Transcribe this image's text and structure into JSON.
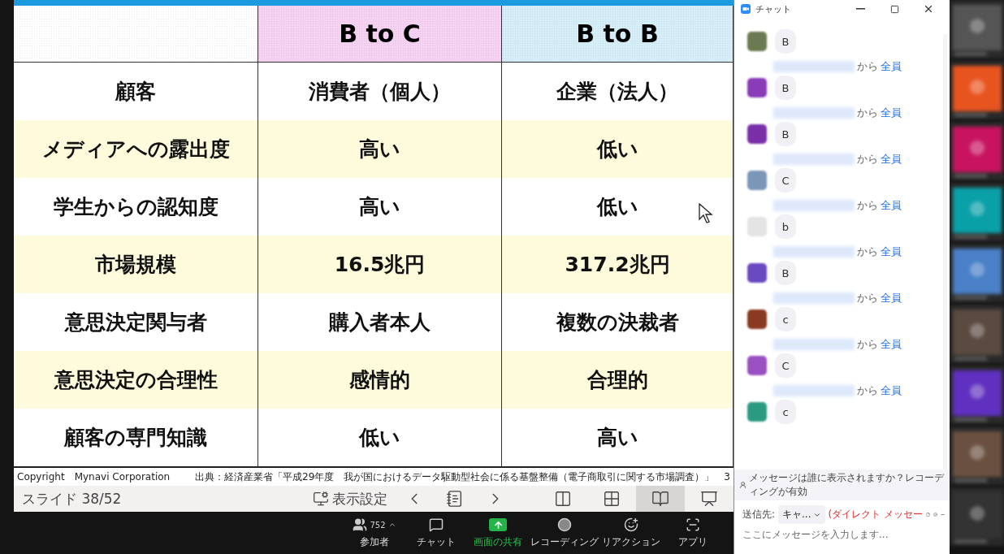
{
  "slide": {
    "table": {
      "header": [
        {
          "color": "#ffffff"
        },
        {
          "label": "B to C",
          "color": "#f6d2f2"
        },
        {
          "label": "B to B",
          "color": "#d6eef8"
        }
      ],
      "rows": [
        {
          "highlighted": false,
          "cells": [
            "顧客",
            "消費者（個人）",
            "企業（法人）"
          ]
        },
        {
          "highlighted": true,
          "cells": [
            "メディアへの露出度",
            "高い",
            "低い"
          ]
        },
        {
          "highlighted": false,
          "cells": [
            "学生からの認知度",
            "高い",
            "低い"
          ]
        },
        {
          "highlighted": true,
          "cells": [
            "市場規模",
            "16.5兆円",
            "317.2兆円"
          ]
        },
        {
          "highlighted": false,
          "cells": [
            "意思決定関与者",
            "購入者本人",
            "複数の決裁者"
          ]
        },
        {
          "highlighted": true,
          "cells": [
            "意思決定の合理性",
            "感情的",
            "合理的"
          ]
        },
        {
          "highlighted": false,
          "cells": [
            "顧客の専門知識",
            "低い",
            "高い"
          ]
        }
      ]
    },
    "copyright": "Copyright　Mynavi Corporation",
    "source": "出典：経済産業省「平成29年度　我が国におけるデータ駆動型社会に係る基盤整備（電子商取引に関する市場調査）」　3"
  },
  "slide_bar": {
    "counter": "スライド 38/52",
    "display_settings": "表示設定",
    "views": [
      {
        "kind": "normal",
        "selected": false
      },
      {
        "kind": "sorter",
        "selected": false
      },
      {
        "kind": "reading",
        "selected": true
      },
      {
        "kind": "show",
        "selected": false
      }
    ]
  },
  "meeting_toolbar": [
    {
      "kind": "participants",
      "label": "参加者",
      "count": "752"
    },
    {
      "kind": "chat",
      "label": "チャット"
    },
    {
      "kind": "share",
      "label": "画面の共有"
    },
    {
      "kind": "record",
      "label": "レコーディング"
    },
    {
      "kind": "reaction",
      "label": "リアクション"
    },
    {
      "kind": "apps",
      "label": "アプリ"
    }
  ],
  "chat": {
    "title": "チャット",
    "messages": [
      {
        "color": "#6b7a50",
        "text": "B"
      },
      {
        "from": "から",
        "to": "全員",
        "color": "#8a3bb8",
        "text": "B"
      },
      {
        "from": "から",
        "to": "全員",
        "color": "#7a2fa8",
        "text": "B"
      },
      {
        "from": "から",
        "to": "全員",
        "color": "#7c96b8",
        "text": "C"
      },
      {
        "from": "から",
        "to": "全員",
        "color": "#e4e4e4",
        "text": "b"
      },
      {
        "from": "から",
        "to": "全員",
        "color": "#6a4ac0",
        "text": "B"
      },
      {
        "from": "から",
        "to": "全員",
        "color": "#8a3a20",
        "text": "c"
      },
      {
        "from": "から",
        "to": "全員",
        "color": "#9a50c0",
        "text": "C"
      },
      {
        "from": "から",
        "to": "全員",
        "color": "#2a9a80",
        "text": "c"
      }
    ],
    "notice": "メッセージは誰に表示されますか？レコーディングが有効",
    "send_to_label": "送信先:",
    "recipient": "キャ...",
    "direct": "(ダイレクト メッセー",
    "placeholder": "ここにメッセージを入力します..."
  }
}
